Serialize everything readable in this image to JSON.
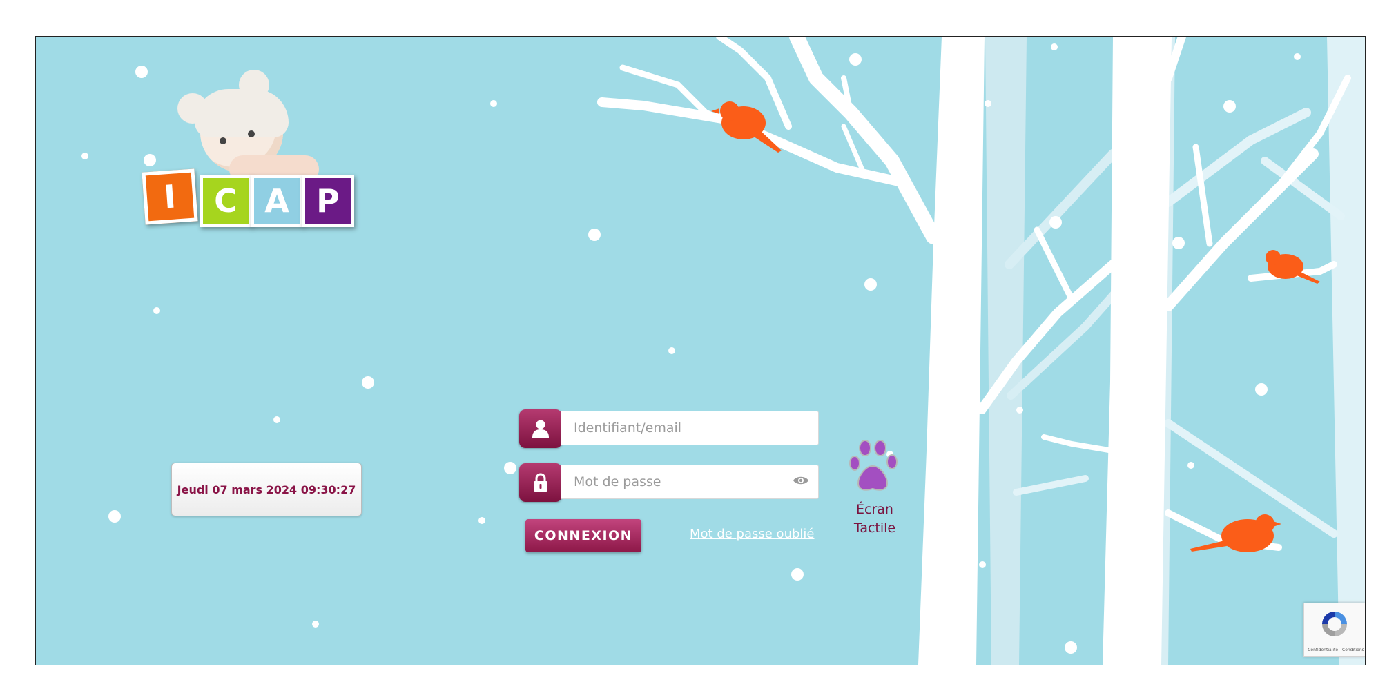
{
  "logo": {
    "letters": [
      "I",
      "C",
      "A",
      "P"
    ]
  },
  "colors": {
    "background": "#a0dbe6",
    "accent": "#9b1f53",
    "tile_i": "#f26a10",
    "tile_c": "#a6d51e",
    "tile_a": "#90cfe3",
    "tile_p": "#6b1a86",
    "bird": "#fb5d18",
    "paw": "#a34fc1"
  },
  "datetime": "Jeudi 07 mars 2024 09:30:27",
  "login": {
    "username_placeholder": "Identifiant/email",
    "username_value": "",
    "password_placeholder": "Mot de passe",
    "password_value": "",
    "submit_label": "CONNEXION",
    "forgot_label": "Mot de passe oublié"
  },
  "touch_screen": {
    "line1": "Écran",
    "line2": "Tactile"
  },
  "recaptcha": {
    "text": "Confidentialité - Conditions"
  },
  "icons": [
    "user-icon",
    "lock-icon",
    "eye-icon",
    "paw-icon",
    "recaptcha-icon"
  ]
}
